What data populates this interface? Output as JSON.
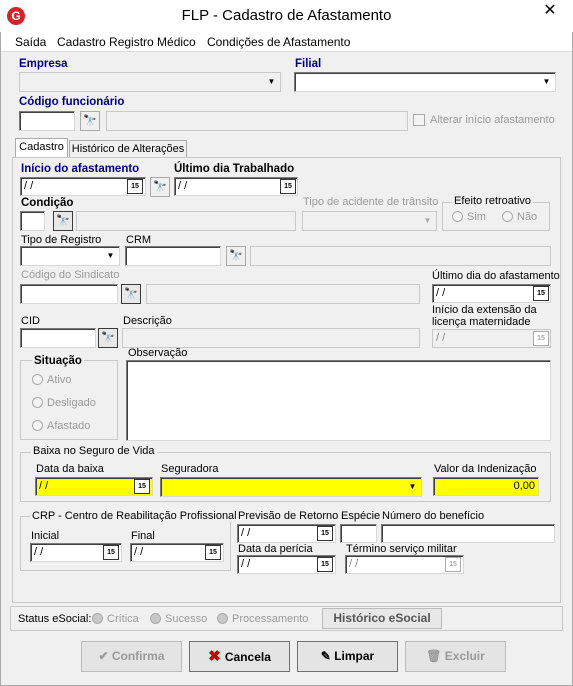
{
  "window": {
    "title": "FLP - Cadastro de Afastamento",
    "close": "✕",
    "icon_letter": "G"
  },
  "menu": [
    "Saída",
    "Cadastro Registro Médico",
    "Condições de Afastamento"
  ],
  "top": {
    "empresa_label": "Empresa",
    "filial_label": "Filial",
    "codigo_label": "Código funcionário",
    "alterar_label": "Alterar início afastamento"
  },
  "tabs": [
    "Cadastro",
    "Histórico de Alterações"
  ],
  "cadastro": {
    "inicio_label": "Início do afastamento",
    "inicio_value": " /  /",
    "ultimo_dia_label": "Último dia Trabalhado",
    "ultimo_dia_value": " /  /",
    "condicao_label": "Condição",
    "tipo_acidente_label": "Tipo de acidente de trânsito",
    "efeito_label": "Efeito retroativo",
    "efeito_sim": "Sim",
    "efeito_nao": "Não",
    "tipo_registro_label": "Tipo de Registro",
    "crm_label": "CRM",
    "sindicato_label": "Código do Sindicato",
    "ultimo_afast_label": "Último dia do afastamento",
    "ultimo_afast_value": " /  /",
    "cid_label": "CID",
    "descricao_label": "Descrição",
    "licenca_label1": "Início da extensão da",
    "licenca_label2": "licença maternidade",
    "licenca_value": " /  /",
    "situacao_label": "Situação",
    "situacao_options": [
      "Ativo",
      "Desligado",
      "Afastado"
    ],
    "observacao_label": "Observação"
  },
  "seguro": {
    "group_label": "Baixa no Seguro de Vida",
    "data_baixa_label": "Data da baixa",
    "data_baixa_value": " /  /",
    "seguradora_label": "Seguradora",
    "valor_label": "Valor da Indenização",
    "valor_value": "0,00"
  },
  "crp": {
    "group_label": "CRP - Centro de Reabilitação Profissional",
    "inicial_label": "Inicial",
    "inicial_value": " /  /",
    "final_label": "Final",
    "final_value": " /  /"
  },
  "retorno": {
    "previsao_label": "Previsão de Retorno",
    "previsao_value": " /  /",
    "especie_label": "Espécie",
    "beneficio_label": "Número do benefício",
    "pericia_label": "Data da perícia",
    "pericia_value": " /  /",
    "militar_label": "Término serviço militar",
    "militar_value": " /  /"
  },
  "esocial": {
    "label": "Status eSocial:",
    "options": [
      "Crítica",
      "Sucesso",
      "Processamento"
    ],
    "historico_button": "Histórico eSocial"
  },
  "buttons": {
    "confirma": "Confirma",
    "cancela": "Cancela",
    "limpar": "Limpar",
    "excluir": "Excluir"
  },
  "icons": {
    "calendar": "15",
    "binoculars": "🔭",
    "dropdown": "▼"
  },
  "colors": {
    "required_blue": "#000080",
    "highlight_yellow": "#ffff00",
    "cancel_red": "#cc0000",
    "brand_red": "#d6232a"
  }
}
